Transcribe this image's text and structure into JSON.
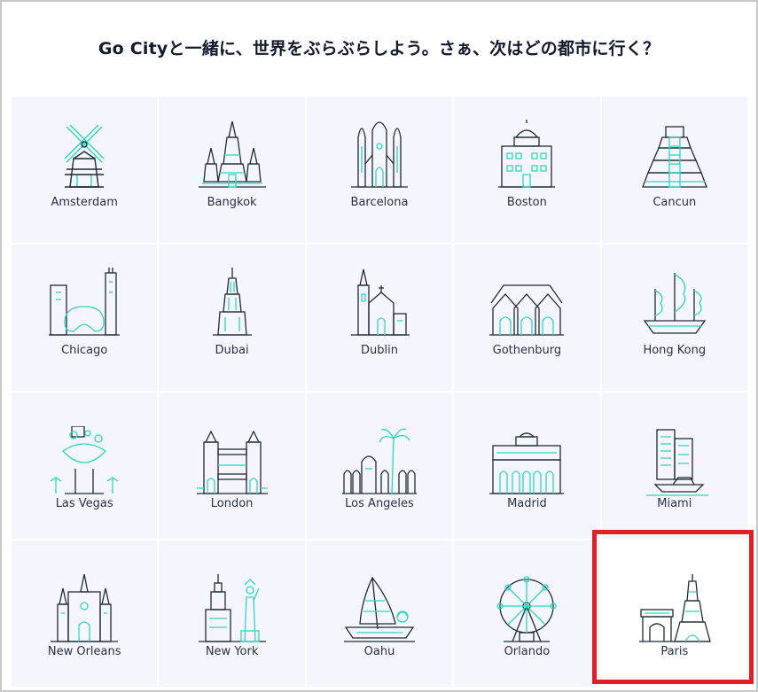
{
  "heading": "Go Cityと一緒に、世界をぶらぶらしよう。さぁ、次はどの都市に行く？",
  "colors": {
    "accent": "#2fd6c3",
    "outline": "#1f2a33",
    "tile_bg": "#f5f6fd",
    "highlight": "#e01f26"
  },
  "cities": [
    {
      "label": "Amsterdam",
      "icon": "windmill-icon"
    },
    {
      "label": "Bangkok",
      "icon": "temple-icon"
    },
    {
      "label": "Barcelona",
      "icon": "cathedral-icon"
    },
    {
      "label": "Boston",
      "icon": "statehouse-icon"
    },
    {
      "label": "Cancun",
      "icon": "pyramid-icon"
    },
    {
      "label": "Chicago",
      "icon": "bean-skyline-icon"
    },
    {
      "label": "Dubai",
      "icon": "tower-icon"
    },
    {
      "label": "Dublin",
      "icon": "church-icon"
    },
    {
      "label": "Gothenburg",
      "icon": "gabled-houses-icon"
    },
    {
      "label": "Hong Kong",
      "icon": "junk-boat-icon"
    },
    {
      "label": "Las Vegas",
      "icon": "vegas-sign-icon"
    },
    {
      "label": "London",
      "icon": "tower-bridge-icon"
    },
    {
      "label": "Los Angeles",
      "icon": "palm-arches-icon"
    },
    {
      "label": "Madrid",
      "icon": "palace-icon"
    },
    {
      "label": "Miami",
      "icon": "hotel-boat-icon"
    },
    {
      "label": "New Orleans",
      "icon": "cathedral-spires-icon"
    },
    {
      "label": "New York",
      "icon": "liberty-skyline-icon"
    },
    {
      "label": "Oahu",
      "icon": "canoe-icon"
    },
    {
      "label": "Orlando",
      "icon": "ferris-wheel-icon"
    },
    {
      "label": "Paris",
      "icon": "eiffel-tower-icon"
    }
  ]
}
